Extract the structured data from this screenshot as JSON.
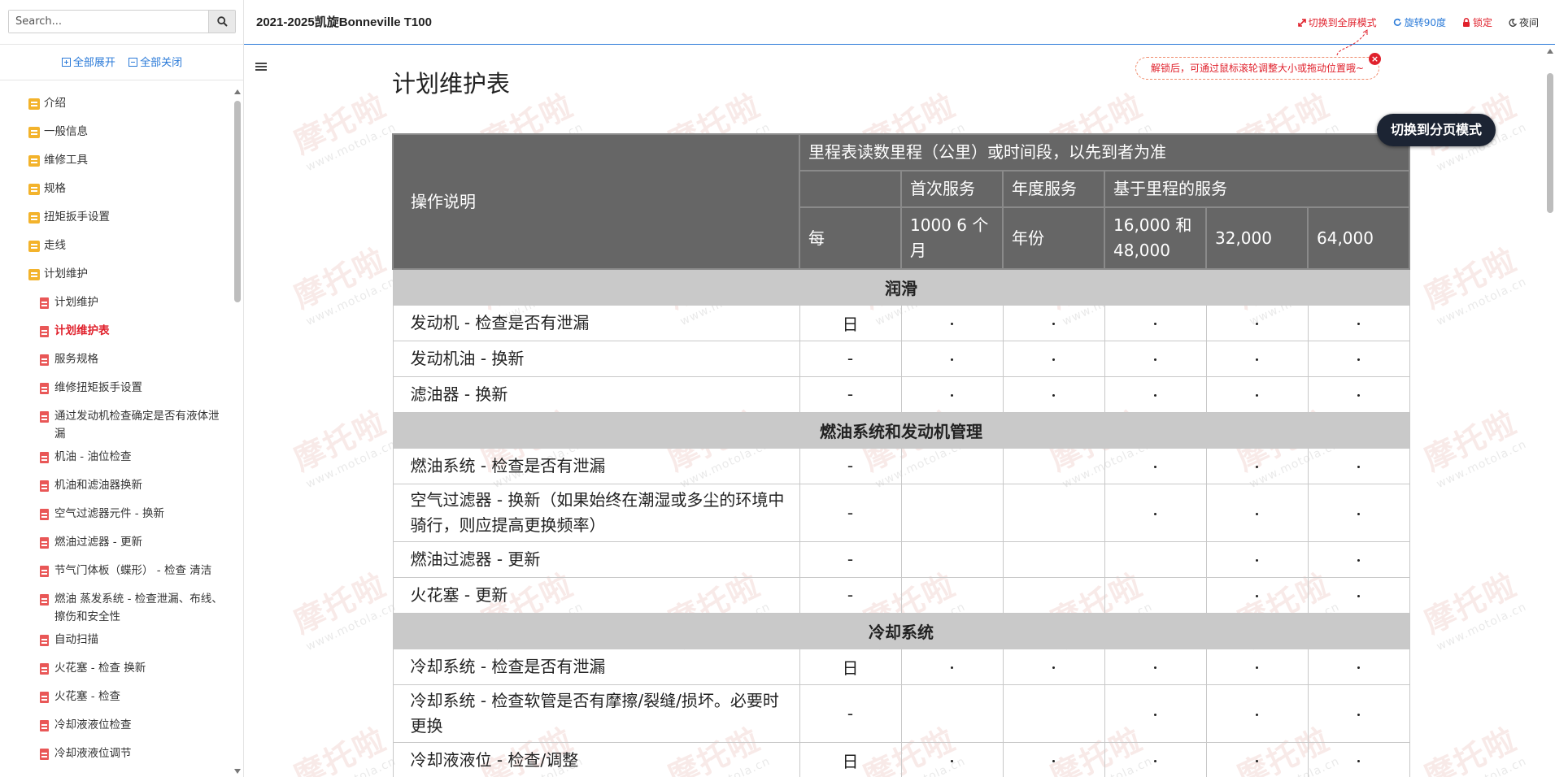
{
  "header": {
    "title": "2021-2025凯旋Bonneville T100",
    "fullscreen_label": "切换到全屏模式",
    "rotate_label": "旋转90度",
    "lock_label": "锁定",
    "night_label": "夜间",
    "hint_text": "解锁后，可通过鼠标滚轮调整大小或拖动位置哦~",
    "hint_close": "×"
  },
  "sidebar": {
    "search_placeholder": "Search...",
    "expand_all": "全部展开",
    "collapse_all": "全部关闭",
    "items": [
      {
        "label": "介绍",
        "level": 1
      },
      {
        "label": "一般信息",
        "level": 1
      },
      {
        "label": "维修工具",
        "level": 1
      },
      {
        "label": "规格",
        "level": 1
      },
      {
        "label": "扭矩扳手设置",
        "level": 1
      },
      {
        "label": "走线",
        "level": 1
      },
      {
        "label": "计划维护",
        "level": 1
      },
      {
        "label": "计划维护",
        "level": 2
      },
      {
        "label": "计划维护表",
        "level": 2,
        "active": true
      },
      {
        "label": "服务规格",
        "level": 2
      },
      {
        "label": "维修扭矩扳手设置",
        "level": 2
      },
      {
        "label": "通过发动机检查确定是否有液体泄漏",
        "level": 2
      },
      {
        "label": "机油 - 油位检查",
        "level": 2
      },
      {
        "label": "机油和滤油器换新",
        "level": 2
      },
      {
        "label": "空气过滤器元件 - 换新",
        "level": 2
      },
      {
        "label": "燃油过滤器 - 更新",
        "level": 2
      },
      {
        "label": "节气门体板（蝶形） - 检查 清洁",
        "level": 2
      },
      {
        "label": "燃油 蒸发系统 - 检查泄漏、布线、擦伤和安全性",
        "level": 2
      },
      {
        "label": "自动扫描",
        "level": 2
      },
      {
        "label": "火花塞 - 检查 换新",
        "level": 2
      },
      {
        "label": "火花塞 - 检查",
        "level": 2
      },
      {
        "label": "冷却液液位检查",
        "level": 2
      },
      {
        "label": "冷却液液位调节",
        "level": 2
      }
    ]
  },
  "main": {
    "doc_title": "计划维护表",
    "switch_mode": "切换到分页模式",
    "watermark_big": "摩托啦",
    "watermark_small": "www.motola.cn",
    "table": {
      "h_op": "操作说明",
      "h_mileage": "里程表读数里程（公里）或时间段，以先到者为准",
      "h_first": "首次服务",
      "h_annual": "年度服务",
      "h_mileage_based": "基于里程的服务",
      "h_every": "每",
      "h_1000": "1000 6 个月",
      "h_year": "年份",
      "h_16000": "16,000 和 48,000",
      "h_32000": "32,000",
      "h_64000": "64,000",
      "sections": [
        {
          "title": "润滑",
          "rows": [
            {
              "desc": "发动机 - 检查是否有泄漏",
              "every": "日",
              "marks": [
                1,
                1,
                1,
                1,
                1
              ]
            },
            {
              "desc": "发动机油 - 换新",
              "every": "-",
              "marks": [
                1,
                1,
                1,
                1,
                1
              ]
            },
            {
              "desc": "滤油器 - 换新",
              "every": "-",
              "marks": [
                1,
                1,
                1,
                1,
                1
              ]
            }
          ]
        },
        {
          "title": "燃油系统和发动机管理",
          "rows": [
            {
              "desc": "燃油系统 - 检查是否有泄漏",
              "every": "-",
              "marks": [
                0,
                0,
                1,
                1,
                1
              ]
            },
            {
              "desc": "空气过滤器 - 换新（如果始终在潮湿或多尘的环境中骑行，则应提高更换频率）",
              "every": "-",
              "marks": [
                0,
                0,
                1,
                1,
                1
              ],
              "tall": true
            },
            {
              "desc": "燃油过滤器 - 更新",
              "every": "-",
              "marks": [
                0,
                0,
                0,
                1,
                1
              ]
            },
            {
              "desc": "火花塞 - 更新",
              "every": "-",
              "marks": [
                0,
                0,
                0,
                1,
                1
              ]
            }
          ]
        },
        {
          "title": "冷却系统",
          "rows": [
            {
              "desc": "冷却系统 - 检查是否有泄漏",
              "every": "日",
              "marks": [
                1,
                1,
                1,
                1,
                1
              ]
            },
            {
              "desc": "冷却系统 - 检查软管是否有摩擦/裂缝/损坏。必要时更换",
              "every": "-",
              "marks": [
                0,
                0,
                1,
                1,
                1
              ],
              "tall": true
            },
            {
              "desc": "冷却液液位 - 检查/调整",
              "every": "日",
              "marks": [
                1,
                1,
                1,
                1,
                1
              ]
            }
          ]
        }
      ]
    }
  }
}
